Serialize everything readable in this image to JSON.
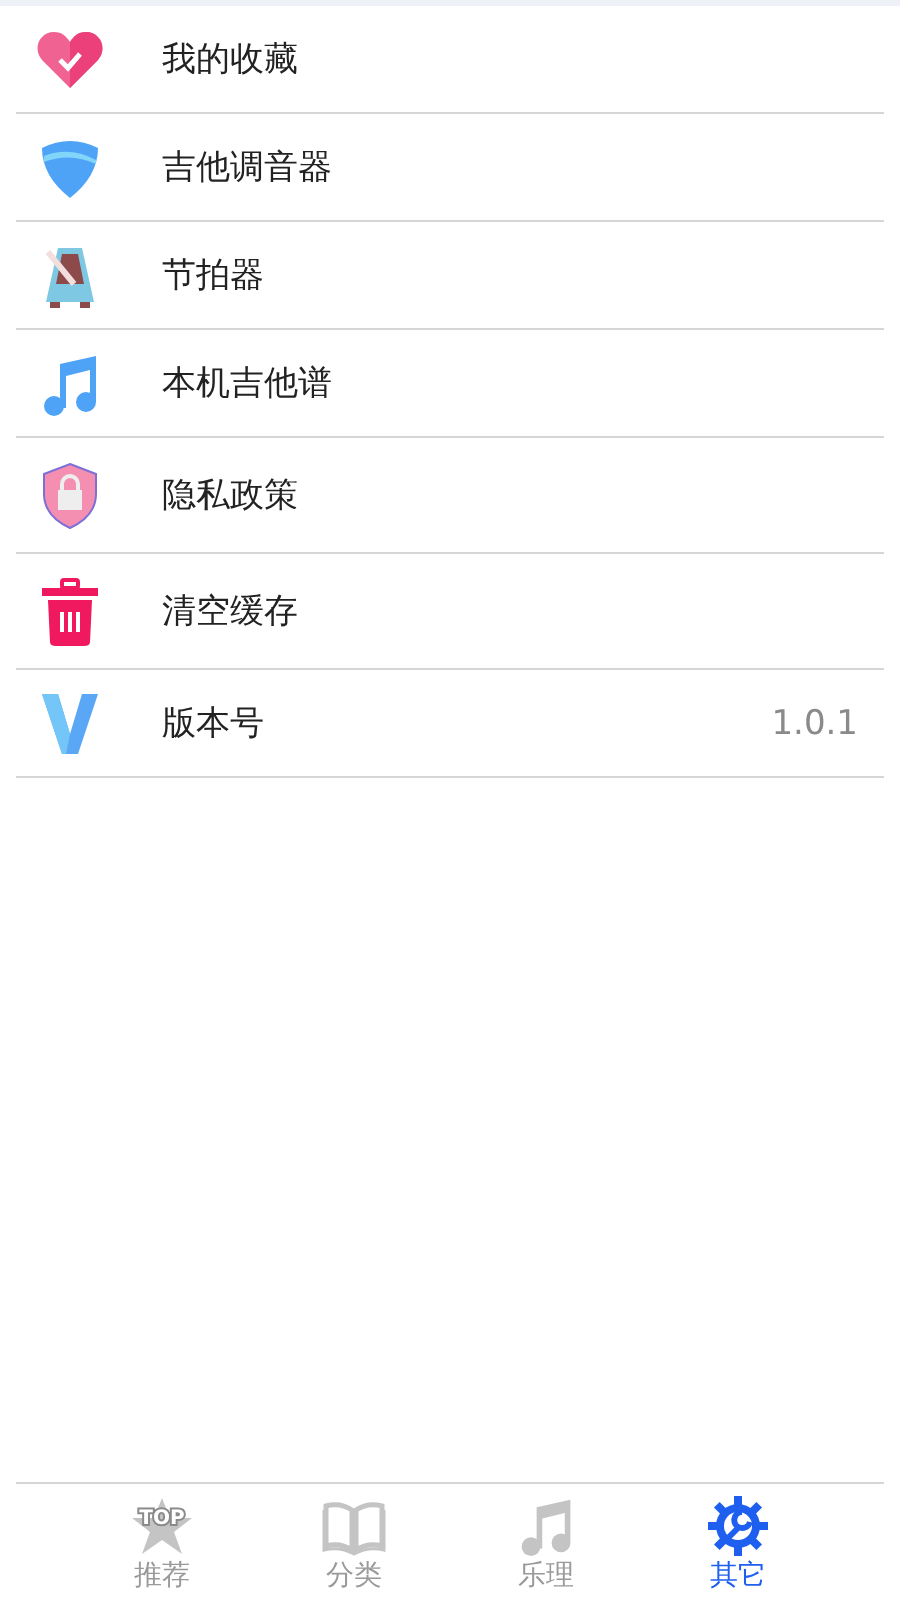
{
  "menu": {
    "items": [
      {
        "label": "我的收藏"
      },
      {
        "label": "吉他调音器"
      },
      {
        "label": "节拍器"
      },
      {
        "label": "本机吉他谱"
      },
      {
        "label": "隐私政策"
      },
      {
        "label": "清空缓存"
      },
      {
        "label": "版本号",
        "value": "1.0.1"
      }
    ]
  },
  "tab_bar": {
    "tabs": [
      {
        "label": "推荐",
        "badge": "TOP",
        "selected": false
      },
      {
        "label": "分类",
        "selected": false
      },
      {
        "label": "乐理",
        "selected": false
      },
      {
        "label": "其它",
        "selected": true
      }
    ]
  }
}
